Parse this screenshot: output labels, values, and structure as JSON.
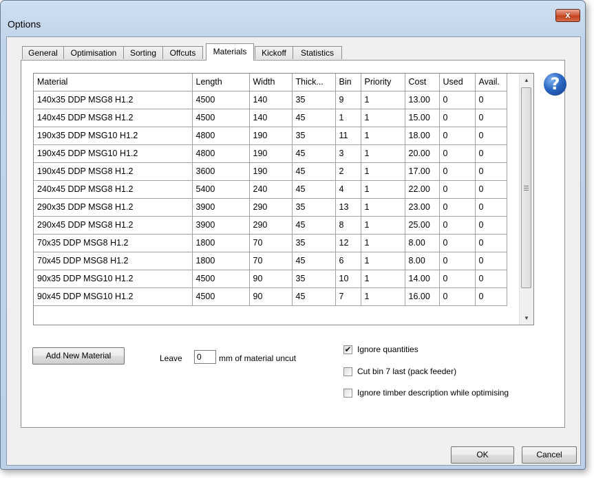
{
  "window": {
    "title": "Options",
    "close_glyph": "x"
  },
  "tabs": [
    {
      "label": "General",
      "active": false
    },
    {
      "label": "Optimisation",
      "active": false
    },
    {
      "label": "Sorting",
      "active": false
    },
    {
      "label": "Offcuts",
      "active": false
    },
    {
      "label": "Materials",
      "active": true
    },
    {
      "label": "Kickoff",
      "active": false
    },
    {
      "label": "Statistics",
      "active": false
    }
  ],
  "grid": {
    "columns": [
      "Material",
      "Length",
      "Width",
      "Thick...",
      "Bin",
      "Priority",
      "Cost",
      "Used",
      "Avail."
    ],
    "rows": [
      [
        "140x35 DDP MSG8 H1.2",
        "4500",
        "140",
        "35",
        "9",
        "1",
        "13.00",
        "0",
        "0"
      ],
      [
        "140x45 DDP MSG8 H1.2",
        "4500",
        "140",
        "45",
        "1",
        "1",
        "15.00",
        "0",
        "0"
      ],
      [
        "190x35 DDP MSG10 H1.2",
        "4800",
        "190",
        "35",
        "11",
        "1",
        "18.00",
        "0",
        "0"
      ],
      [
        "190x45 DDP MSG10 H1.2",
        "4800",
        "190",
        "45",
        "3",
        "1",
        "20.00",
        "0",
        "0"
      ],
      [
        "190x45 DDP MSG8 H1.2",
        "3600",
        "190",
        "45",
        "2",
        "1",
        "17.00",
        "0",
        "0"
      ],
      [
        "240x45 DDP MSG8 H1.2",
        "5400",
        "240",
        "45",
        "4",
        "1",
        "22.00",
        "0",
        "0"
      ],
      [
        "290x35 DDP MSG8 H1.2",
        "3900",
        "290",
        "35",
        "13",
        "1",
        "23.00",
        "0",
        "0"
      ],
      [
        "290x45 DDP MSG8 H1.2",
        "3900",
        "290",
        "45",
        "8",
        "1",
        "25.00",
        "0",
        "0"
      ],
      [
        "70x35 DDP MSG8 H1.2",
        "1800",
        "70",
        "35",
        "12",
        "1",
        "8.00",
        "0",
        "0"
      ],
      [
        "70x45 DDP MSG8 H1.2",
        "1800",
        "70",
        "45",
        "6",
        "1",
        "8.00",
        "0",
        "0"
      ],
      [
        "90x35 DDP MSG10 H1.2",
        "4500",
        "90",
        "35",
        "10",
        "1",
        "14.00",
        "0",
        "0"
      ],
      [
        "90x45 DDP MSG10 H1.2",
        "4500",
        "90",
        "45",
        "7",
        "1",
        "16.00",
        "0",
        "0"
      ]
    ]
  },
  "help": {
    "glyph": "?"
  },
  "add_material_button": "Add New Material",
  "leave": {
    "prefix": "Leave",
    "value": "0",
    "suffix": "mm of material uncut"
  },
  "checkboxes": [
    {
      "label": "Ignore quantities",
      "checked": true
    },
    {
      "label": "Cut bin 7 last (pack feeder)",
      "checked": false
    },
    {
      "label": "Ignore timber description while optimising",
      "checked": false
    }
  ],
  "buttons": {
    "ok": "OK",
    "cancel": "Cancel"
  }
}
